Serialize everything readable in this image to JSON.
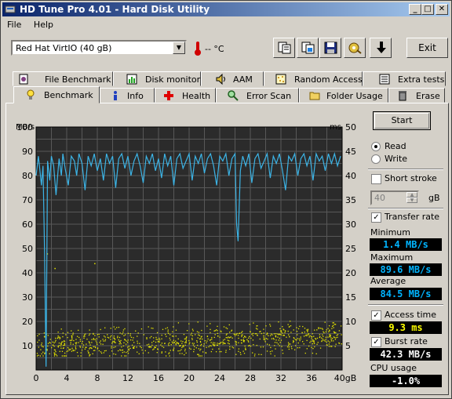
{
  "window": {
    "title": "HD Tune Pro 4.01 - Hard Disk Utility"
  },
  "menu": {
    "file": "File",
    "help": "Help"
  },
  "drive": {
    "selected": "Red Hat VirtIO (40 gB)"
  },
  "temperature": {
    "text": "-- °C"
  },
  "toolbar": {
    "icons": [
      "copy-text-icon",
      "copy-image-icon",
      "save-icon",
      "options-icon",
      "download-icon"
    ],
    "exit_label": "Exit"
  },
  "tabs_row1": [
    {
      "label": "File Benchmark",
      "icon": "file-benchmark-icon"
    },
    {
      "label": "Disk monitor",
      "icon": "disk-monitor-icon"
    },
    {
      "label": "AAM",
      "icon": "speaker-icon"
    },
    {
      "label": "Random Access",
      "icon": "random-access-icon"
    },
    {
      "label": "Extra tests",
      "icon": "extra-tests-icon"
    }
  ],
  "tabs_row2": [
    {
      "label": "Benchmark",
      "icon": "benchmark-icon",
      "active": true
    },
    {
      "label": "Info",
      "icon": "info-icon"
    },
    {
      "label": "Health",
      "icon": "health-icon"
    },
    {
      "label": "Error Scan",
      "icon": "error-scan-icon"
    },
    {
      "label": "Folder Usage",
      "icon": "folder-icon"
    },
    {
      "label": "Erase",
      "icon": "trash-icon"
    }
  ],
  "controls": {
    "start_label": "Start",
    "read_label": "Read",
    "write_label": "Write",
    "mode": "read",
    "short_stroke_label": "Short stroke",
    "short_stroke_checked": false,
    "short_stroke_value": "40",
    "short_stroke_unit": "gB",
    "transfer_rate_label": "Transfer rate",
    "transfer_rate_checked": true,
    "access_time_label": "Access time",
    "access_time_checked": true,
    "burst_rate_label": "Burst rate",
    "burst_rate_checked": true
  },
  "stats": {
    "minimum_label": "Minimum",
    "minimum": "1.4 MB/s",
    "maximum_label": "Maximum",
    "maximum": "89.6 MB/s",
    "average_label": "Average",
    "average": "84.5 MB/s",
    "access_time": "9.3 ms",
    "burst_rate": "42.3 MB/s",
    "cpu_label": "CPU usage",
    "cpu": "-1.0%"
  },
  "chart_data": {
    "type": "line",
    "left_axis_label": "MB/s",
    "right_axis_label": "ms",
    "x_unit_label": "40gB",
    "xlim": [
      0,
      40
    ],
    "ylim_left": [
      0,
      100
    ],
    "ylim_right": [
      0,
      50
    ],
    "x_ticks": [
      "0",
      "4",
      "8",
      "12",
      "16",
      "20",
      "24",
      "28",
      "32",
      "36"
    ],
    "y_left_ticks": [
      "10",
      "20",
      "30",
      "40",
      "50",
      "60",
      "70",
      "80",
      "90",
      "100"
    ],
    "y_right_ticks": [
      "5",
      "10",
      "15",
      "20",
      "25",
      "30",
      "35",
      "40",
      "45",
      "50"
    ],
    "grid": true,
    "colors": {
      "background": "#2b2b2b",
      "grid": "#585858",
      "transfer": "#3cb4e6",
      "access": "#e6e600"
    },
    "transfer_rate_series": {
      "name": "Transfer rate",
      "x": [
        0,
        0.3,
        0.5,
        0.7,
        0.9,
        1.1,
        1.3,
        1.5,
        1.8,
        2.0,
        2.3,
        2.6,
        3.0,
        3.3,
        3.5,
        3.8,
        4.2,
        4.6,
        5.0,
        5.3,
        5.6,
        6.0,
        6.4,
        6.8,
        7.2,
        7.6,
        8.0,
        8.4,
        8.8,
        9.2,
        9.6,
        10.0,
        10.4,
        10.8,
        11.2,
        11.6,
        12.0,
        12.4,
        12.8,
        13.2,
        13.6,
        14.0,
        14.4,
        14.8,
        15.2,
        15.6,
        16.0,
        16.4,
        16.8,
        17.2,
        17.6,
        18.0,
        18.4,
        18.8,
        19.2,
        19.6,
        20.0,
        20.4,
        20.8,
        21.2,
        21.6,
        22.0,
        22.4,
        22.8,
        23.2,
        23.6,
        24.0,
        24.4,
        24.8,
        25.2,
        25.6,
        26.0,
        26.2,
        26.4,
        26.7,
        27.0,
        27.4,
        27.8,
        28.2,
        28.6,
        29.0,
        29.4,
        29.8,
        30.2,
        30.6,
        31.0,
        31.4,
        31.8,
        32.2,
        32.6,
        33.0,
        33.4,
        33.8,
        34.2,
        34.6,
        35.0,
        35.4,
        35.8,
        36.2,
        36.6,
        37.0,
        37.4,
        37.8,
        38.2,
        38.6,
        39.0,
        39.4,
        39.8
      ],
      "y": [
        80,
        88,
        82,
        76,
        84,
        50,
        1.4,
        86,
        78,
        88,
        84,
        72,
        87,
        80,
        89,
        83,
        76,
        88,
        86,
        80,
        89,
        85,
        74,
        88,
        84,
        89,
        82,
        87,
        78,
        89,
        85,
        88,
        75,
        87,
        89,
        83,
        88,
        80,
        86,
        89,
        84,
        77,
        88,
        85,
        89,
        82,
        87,
        79,
        89,
        84,
        88,
        76,
        87,
        89,
        83,
        86,
        89,
        78,
        88,
        85,
        89,
        81,
        87,
        89,
        84,
        76,
        88,
        86,
        89,
        80,
        87,
        89,
        60,
        53,
        82,
        88,
        84,
        89,
        77,
        87,
        89,
        83,
        86,
        89,
        79,
        88,
        85,
        89,
        82,
        74,
        88,
        86,
        89,
        80,
        87,
        89,
        84,
        88,
        78,
        89,
        86,
        88,
        82,
        89,
        85,
        89,
        84,
        88
      ]
    },
    "access_time_series": {
      "name": "Access time",
      "x_range": [
        0,
        40
      ],
      "y_range_ms": [
        3,
        14
      ],
      "count": 900
    }
  }
}
